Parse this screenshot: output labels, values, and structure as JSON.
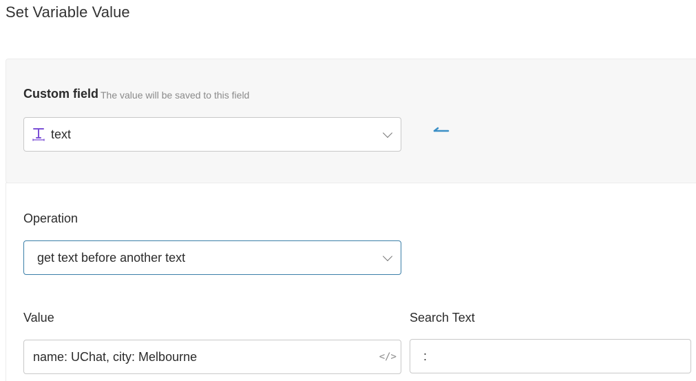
{
  "page": {
    "title": "Set Variable Value"
  },
  "custom_field": {
    "label": "Custom field",
    "hint": "The value will be saved to this field",
    "selected": "text",
    "type_icon": "text-type-icon",
    "accent_color": "#7b4fd6"
  },
  "arrow": {
    "icon": "arrow-left-icon",
    "color": "#3b8fc6"
  },
  "operation": {
    "label": "Operation",
    "selected": "get text before another text"
  },
  "value": {
    "label": "Value",
    "text": "name: UChat, city: Melbourne",
    "icon": "code-icon",
    "icon_glyph": "</>"
  },
  "search_text": {
    "label": "Search Text",
    "text": ":"
  }
}
